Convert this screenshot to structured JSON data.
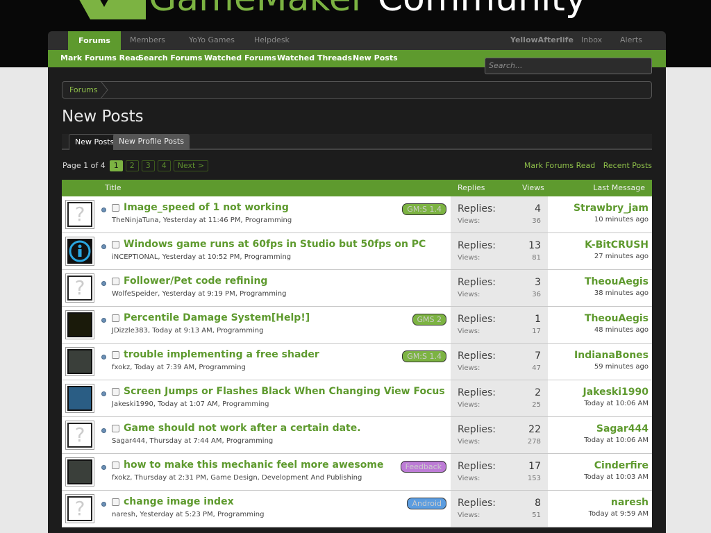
{
  "site": {
    "title_prefix": "GameMaker",
    "title_suffix": " Community"
  },
  "nav": {
    "tabs": [
      "Forums",
      "Members",
      "YoYo Games",
      "Helpdesk"
    ],
    "user": "YellowAfterlife",
    "inbox": "Inbox",
    "alerts": "Alerts"
  },
  "subnav": [
    "Mark Forums Read",
    "Search Forums",
    "Watched Forums",
    "Watched Threads",
    "New Posts"
  ],
  "search": {
    "placeholder": "Search..."
  },
  "breadcrumb": "Forums",
  "page_title": "New Posts",
  "content_tabs": [
    "New Posts",
    "New Profile Posts"
  ],
  "pager": {
    "label": "Page 1 of 4",
    "pages": [
      "1",
      "2",
      "3",
      "4"
    ],
    "next": "Next >"
  },
  "right_links": [
    "Mark Forums Read",
    "Recent Posts"
  ],
  "columns": {
    "title": "Title",
    "replies": "Replies",
    "views": "Views",
    "last": "Last Message"
  },
  "labels": {
    "replies": "Replies:",
    "views": "Views:"
  },
  "threads": [
    {
      "avatar": "blank-avatar",
      "title": "Image_speed of 1 not working",
      "meta": "TheNinjaTuna, Yesterday at 11:46 PM, Programming",
      "prefix": "GM:S 1.4",
      "prefix_color": "#7cb342",
      "replies": "4",
      "views": "36",
      "last_user": "Strawbry_jam",
      "last_time": "10 minutes ago"
    },
    {
      "avatar": "blue-logo-avatar",
      "title": "Windows game runs at 60fps in Studio but 50fps on PC",
      "meta": "iNCEPTIONAL, Yesterday at 10:52 PM, Programming",
      "prefix": "",
      "prefix_color": "",
      "replies": "13",
      "views": "81",
      "last_user": "K-BitCRUSH",
      "last_time": "27 minutes ago"
    },
    {
      "avatar": "blank-avatar",
      "title": "Follower/Pet code refining",
      "meta": "WolfeSpeider, Yesterday at 9:19 PM, Programming",
      "prefix": "",
      "prefix_color": "",
      "replies": "3",
      "views": "36",
      "last_user": "TheouAegis",
      "last_time": "38 minutes ago"
    },
    {
      "avatar": "zelda-avatar",
      "title": "Percentile Damage System[Help!]",
      "meta": "JDizzle383, Today at 9:13 AM, Programming",
      "prefix": "GMS 2",
      "prefix_color": "#7cb342",
      "replies": "1",
      "views": "17",
      "last_user": "TheouAegis",
      "last_time": "48 minutes ago"
    },
    {
      "avatar": "dark-avatar",
      "title": "trouble implementing a free shader",
      "meta": "fxokz, Today at 7:39 AM, Programming",
      "prefix": "GM:S 1.4",
      "prefix_color": "#7cb342",
      "replies": "7",
      "views": "47",
      "last_user": "IndianaBones",
      "last_time": "59 minutes ago"
    },
    {
      "avatar": "sonic-avatar",
      "title": "Screen Jumps or Flashes Black When Changing View Focus",
      "meta": "Jakeski1990, Today at 1:07 AM, Programming",
      "prefix": "",
      "prefix_color": "",
      "replies": "2",
      "views": "25",
      "last_user": "Jakeski1990",
      "last_time": "Today at 10:06 AM"
    },
    {
      "avatar": "blank-avatar",
      "title": "Game should not work after a certain date.",
      "meta": "Sagar444, Thursday at 7:44 AM, Programming",
      "prefix": "",
      "prefix_color": "",
      "replies": "22",
      "views": "278",
      "last_user": "Sagar444",
      "last_time": "Today at 10:06 AM"
    },
    {
      "avatar": "dark-avatar",
      "title": "how to make this mechanic feel more awesome",
      "meta": "fxokz, Thursday at 2:31 PM, Game Design, Development And Publishing",
      "prefix": "Feedback",
      "prefix_color": "#bd7bd6",
      "replies": "17",
      "views": "153",
      "last_user": "Cinderfire",
      "last_time": "Today at 10:03 AM"
    },
    {
      "avatar": "blank-avatar",
      "title": "change image index",
      "meta": "naresh, Yesterday at 5:23 PM, Programming",
      "prefix": "Android",
      "prefix_color": "#5c9de0",
      "replies": "8",
      "views": "51",
      "last_user": "naresh",
      "last_time": "Today at 9:59 AM"
    }
  ]
}
